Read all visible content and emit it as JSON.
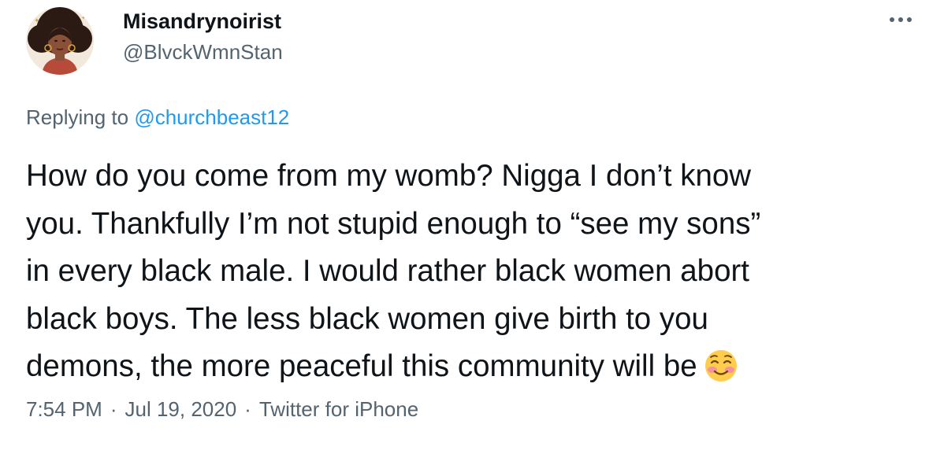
{
  "author": {
    "display_name": "Misandrynoirist",
    "handle": "@BlvckWmnStan",
    "avatar_icon": "avatar-illustration"
  },
  "more_icon": "more-horizontal-icon",
  "reply": {
    "prefix": "Replying to ",
    "mention": "@churchbeast12",
    "mention_color": "#1d9bf0"
  },
  "body": {
    "lines": [
      "How do you come from my womb? Nigga I don’t know",
      "you. Thankfully I’m not stupid enough to “see my sons”",
      "in every black male. I would rather black women abort",
      "black boys. The less black women give birth to you",
      "demons, the more peaceful this community will be"
    ],
    "emoji": "smiling-face-with-blush-icon"
  },
  "meta": {
    "time": "7:54 PM",
    "date": "Jul 19, 2020",
    "source": "Twitter for iPhone",
    "separator": "·"
  },
  "colors": {
    "text": "#0f1419",
    "secondary": "#536471",
    "link": "#1d9bf0"
  }
}
